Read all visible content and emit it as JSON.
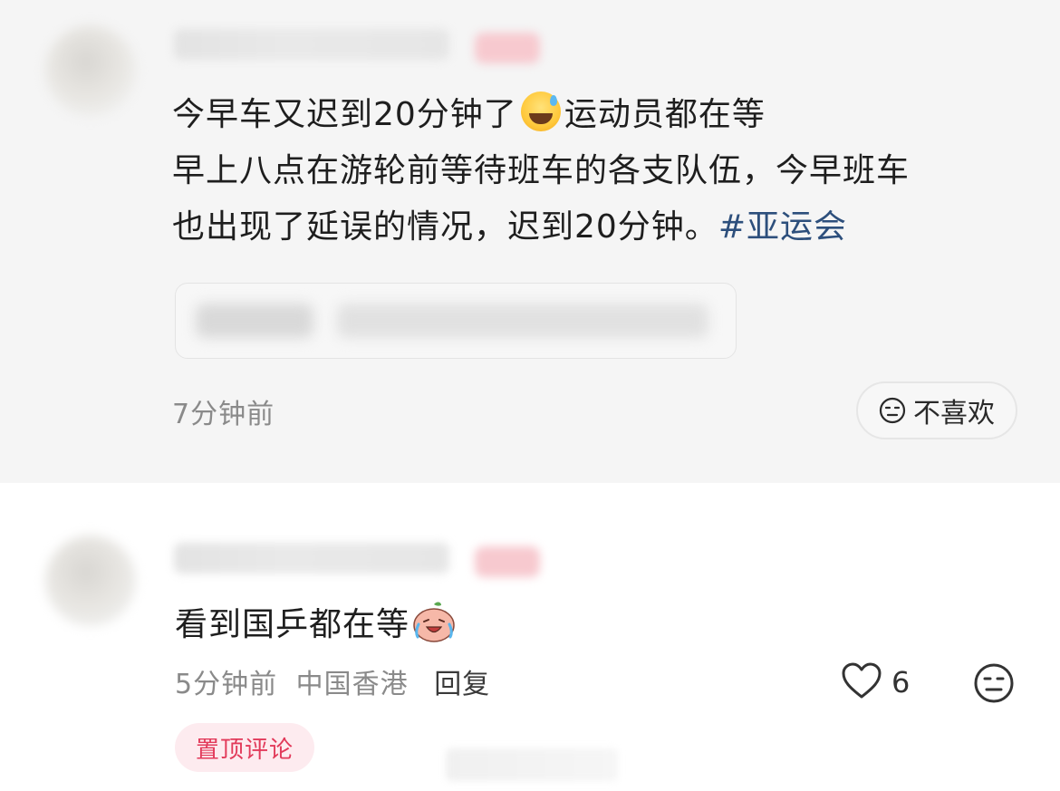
{
  "post": {
    "lines": [
      {
        "before": "今早车又迟到20分钟了",
        "after": "运动员都在等"
      },
      {
        "text": "早上八点在游轮前等待班车的各支队伍，今早班车"
      },
      {
        "text": "也出现了延误的情况，迟到20分钟。",
        "hashtag": "#亚运会"
      }
    ],
    "emoji": "grinning-face-with-sweat",
    "time": "7分钟前",
    "dislike_label": "不喜欢"
  },
  "comment": {
    "text": "看到国乒都在等",
    "emoji": "crying-laughing-peach-face",
    "time": "5分钟前",
    "location": "中国香港",
    "reply_label": "回复",
    "like_count": "6",
    "pinned_label": "置顶评论"
  },
  "colors": {
    "hashtag": "#2d4f7c",
    "pinned_text": "#e23a5a",
    "pinned_bg": "#fdebef",
    "meta_gray": "#8a8a8a"
  },
  "icons": {
    "dislike": "neutral-face-icon",
    "like": "heart-outline-icon"
  }
}
